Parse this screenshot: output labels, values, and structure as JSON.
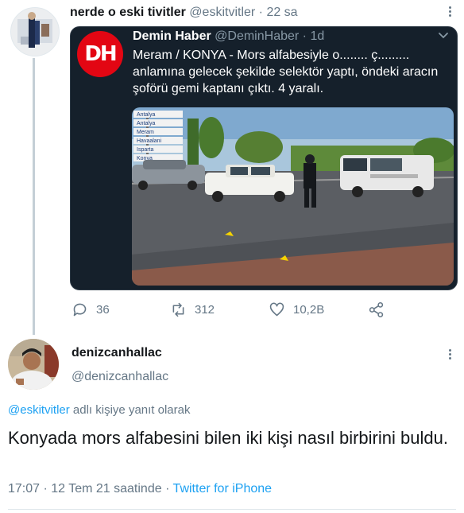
{
  "tweet": {
    "author_name": "nerde o eski tivitler",
    "author_handle": "@eskitvitler",
    "time_sep": " · ",
    "time": "22 sa",
    "quoted": {
      "logo_text": "DH",
      "author_name": "Demin Haber",
      "author_handle": "@DeminHaber",
      "time_sep": " · ",
      "time": "1d",
      "text": "Meram / KONYA - Mors alfabesiyle o........ ç......... anlamına gelecek şekilde selektör yaptı, öndeki aracın şoförü gemi kaptanı çıktı. 4 yaralı.",
      "photo_signs": [
        "Antalya",
        "Antalya",
        "Meram",
        "Havaalani",
        "Isparta",
        "Konya"
      ]
    },
    "actions": {
      "replies": "36",
      "retweets": "312",
      "likes": "10,2B"
    }
  },
  "reply": {
    "author_name": "denizcanhallac",
    "author_handle": "@denizcanhallac",
    "reply_to_mention": "@eskitvitler",
    "reply_to_suffix": " adlı kişiye yanıt olarak",
    "text": "Konyada mors alfabesini bilen iki kişi nasıl birbirini buldu.",
    "time": "17:07 · 12 Tem 21 saatinde · ",
    "source": "Twitter for iPhone"
  },
  "colors": {
    "link": "#1da1f2",
    "muted": "#657786",
    "card_bg": "#15202b",
    "logo_red": "#e30613"
  }
}
